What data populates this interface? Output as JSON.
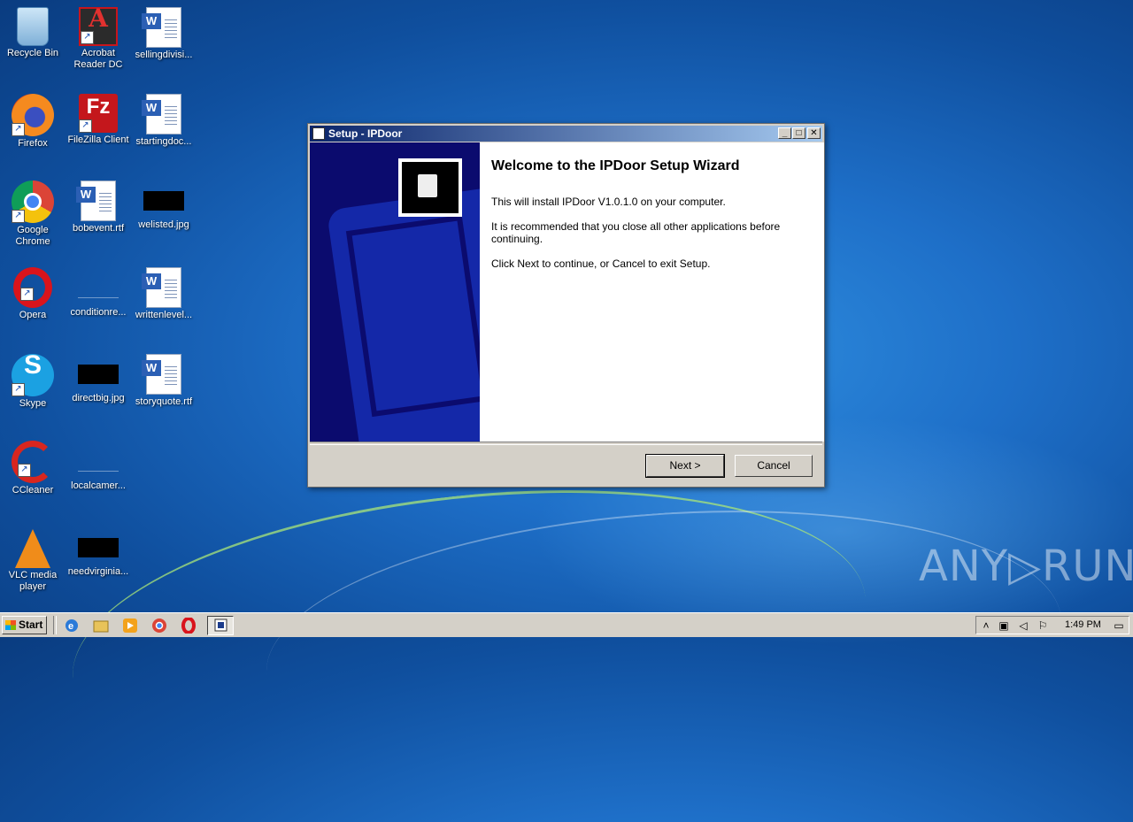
{
  "desktop": {
    "icons": [
      {
        "label": "Recycle Bin"
      },
      {
        "label": "Acrobat Reader DC"
      },
      {
        "label": "sellingdivisi..."
      },
      {
        "label": "Firefox"
      },
      {
        "label": "FileZilla Client"
      },
      {
        "label": "startingdoc..."
      },
      {
        "label": "Google Chrome"
      },
      {
        "label": "bobevent.rtf"
      },
      {
        "label": "welisted.jpg"
      },
      {
        "label": "Opera"
      },
      {
        "label": "conditionre..."
      },
      {
        "label": "writtenlevel..."
      },
      {
        "label": "Skype"
      },
      {
        "label": "directbig.jpg"
      },
      {
        "label": "storyquote.rtf"
      },
      {
        "label": "CCleaner"
      },
      {
        "label": "localcamer..."
      },
      {
        "label": "VLC media player"
      },
      {
        "label": "needvirginia..."
      }
    ]
  },
  "dialog": {
    "title": "Setup - IPDoor",
    "heading": "Welcome to the IPDoor Setup Wizard",
    "line1": "This will install IPDoor V1.0.1.0 on your computer.",
    "line2": "It is recommended that you close all other applications before continuing.",
    "line3": "Click Next to continue, or Cancel to exit Setup.",
    "next_label": "Next >",
    "cancel_label": "Cancel",
    "minimize_glyph": "_",
    "maximize_glyph": "□",
    "close_glyph": "✕"
  },
  "watermark": "ANY▷RUN",
  "taskbar": {
    "start_label": "Start",
    "clock": "1:49 PM",
    "quicklaunch": [
      "ie-icon",
      "explorer-icon",
      "media-player-icon",
      "chrome-icon",
      "opera-icon"
    ]
  }
}
